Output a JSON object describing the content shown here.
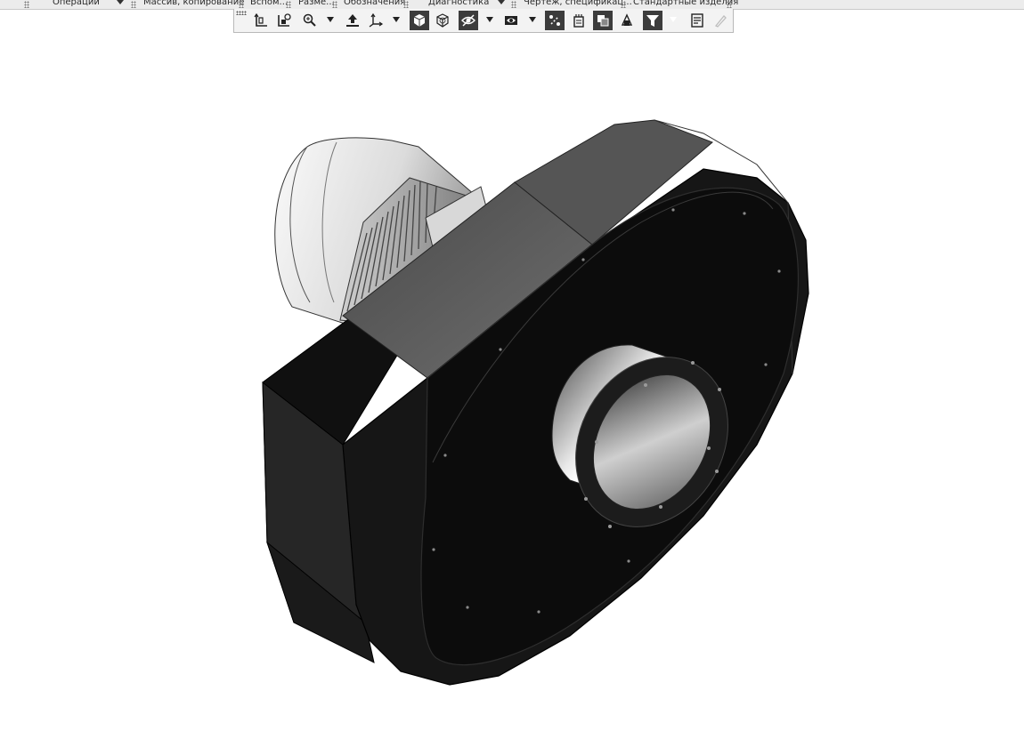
{
  "panels": {
    "operations": "Операции",
    "array_copy": "Массив, копирование",
    "auxiliary": "Вспом...",
    "dimensions": "Разме...",
    "designations": "Обозначения",
    "diagnostics": "Диагностика",
    "drawing_spec": "Чертеж, спецификац...",
    "standard_parts": "Стандартные изделия"
  },
  "view_toolbar": {
    "buttons": [
      "orientation-icon",
      "coordinate-system-icon",
      "zoom-icon",
      "zoom-dropdown",
      "rotate-icon",
      "axis-icon",
      "axis-dropdown",
      "shaded-with-edges-icon",
      "wireframe-icon",
      "hide-icon",
      "hide-dropdown",
      "visibility-icon",
      "visibility-dropdown",
      "section-icon",
      "display-mode-icon",
      "component-icon",
      "show-all-icon",
      "filter-icon",
      "filter-dropdown",
      "properties-icon",
      "pick-icon"
    ]
  },
  "colors": {
    "panel_bg": "#ececec",
    "toolbar_bg": "#f3f3f3",
    "active_button": "#3c3c3c",
    "housing": "#141414",
    "motor": "#f0f0f0"
  }
}
